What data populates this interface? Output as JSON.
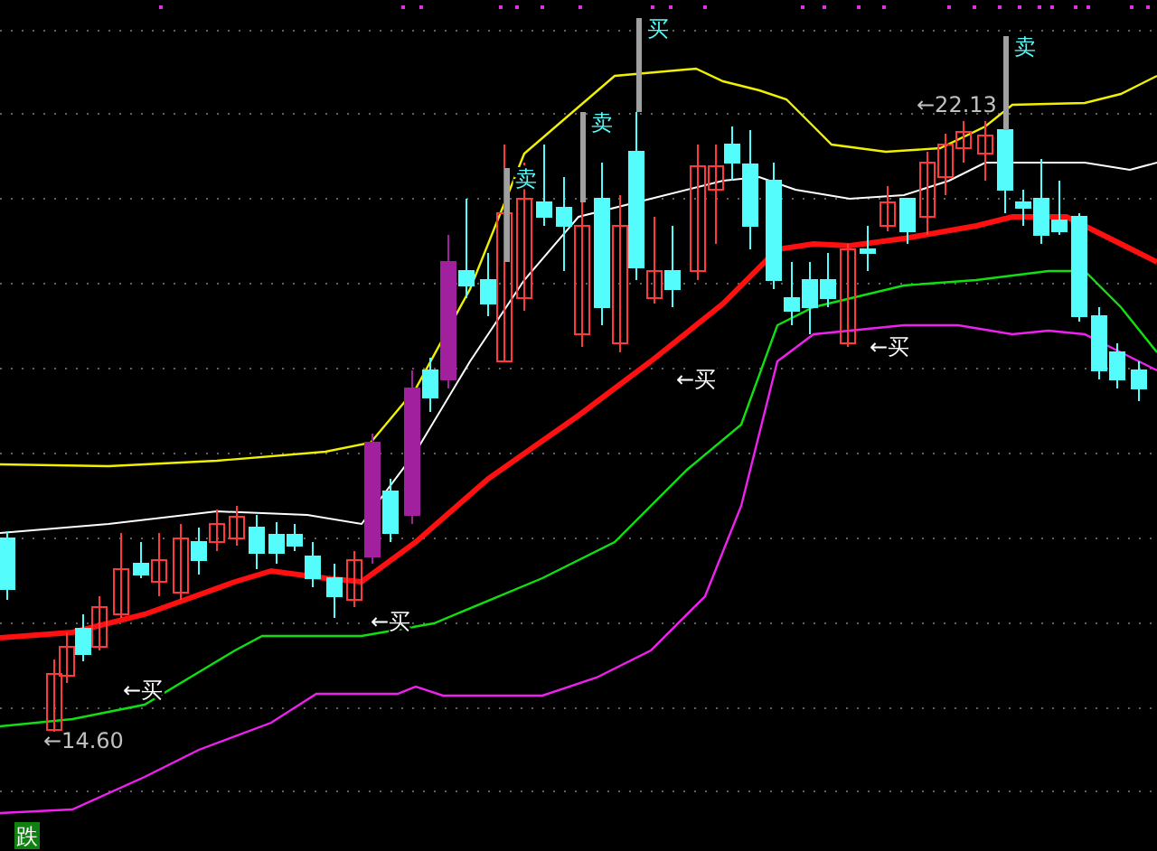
{
  "signal_markers": [
    {
      "text": "卖"
    },
    {
      "text": "卖"
    },
    {
      "text": "买"
    },
    {
      "text": "卖"
    }
  ],
  "buy_labels": [
    {
      "text": "←买"
    },
    {
      "text": "←买"
    },
    {
      "text": "←买"
    },
    {
      "text": "←买"
    }
  ],
  "price_labels": [
    {
      "text": "←22.13"
    },
    {
      "text": "←14.60"
    }
  ],
  "trend_badge": {
    "text": "跌"
  }
}
